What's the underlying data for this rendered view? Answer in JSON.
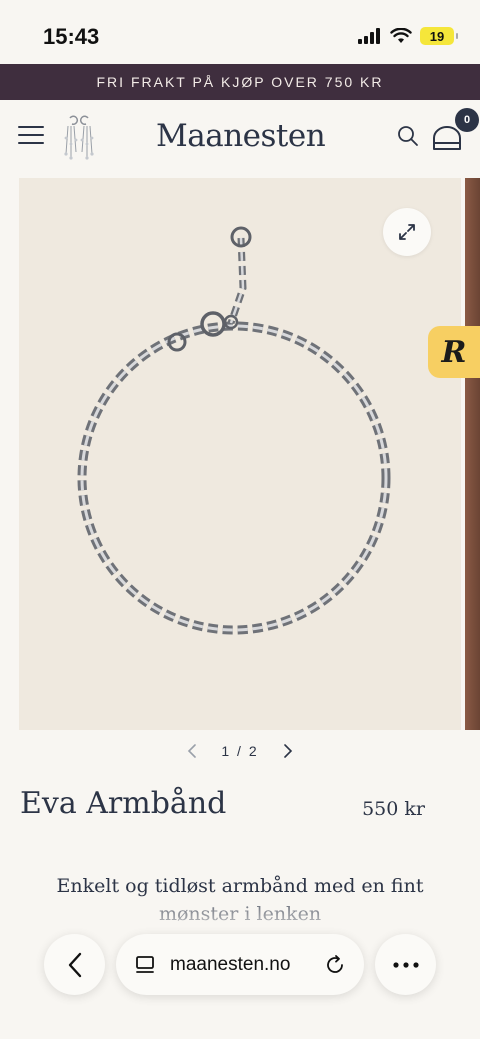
{
  "status_bar": {
    "time": "15:43",
    "battery": "19"
  },
  "promo": {
    "text": "FRI FRAKT PÅ KJØP OVER 750 KR"
  },
  "header": {
    "logo": "Maanesten",
    "cart_count": "0",
    "icons": [
      "menu-icon",
      "earring-icon",
      "search-icon",
      "bag-icon"
    ]
  },
  "gallery": {
    "pager": "1 / 2",
    "image": "silver-chain-bracelet",
    "rewards_badge": "R"
  },
  "product": {
    "title": "Eva Armbånd",
    "price": "550 kr",
    "description": "Enkelt og tidløst armbånd med en fint mønster i lenken"
  },
  "browser": {
    "url": "maanesten.no"
  },
  "colors": {
    "accent": "#3f2e3e",
    "text": "#2c3446",
    "background": "#f8f6f2",
    "image_bg": "#efe9df",
    "rewards": "#f7cf62"
  }
}
